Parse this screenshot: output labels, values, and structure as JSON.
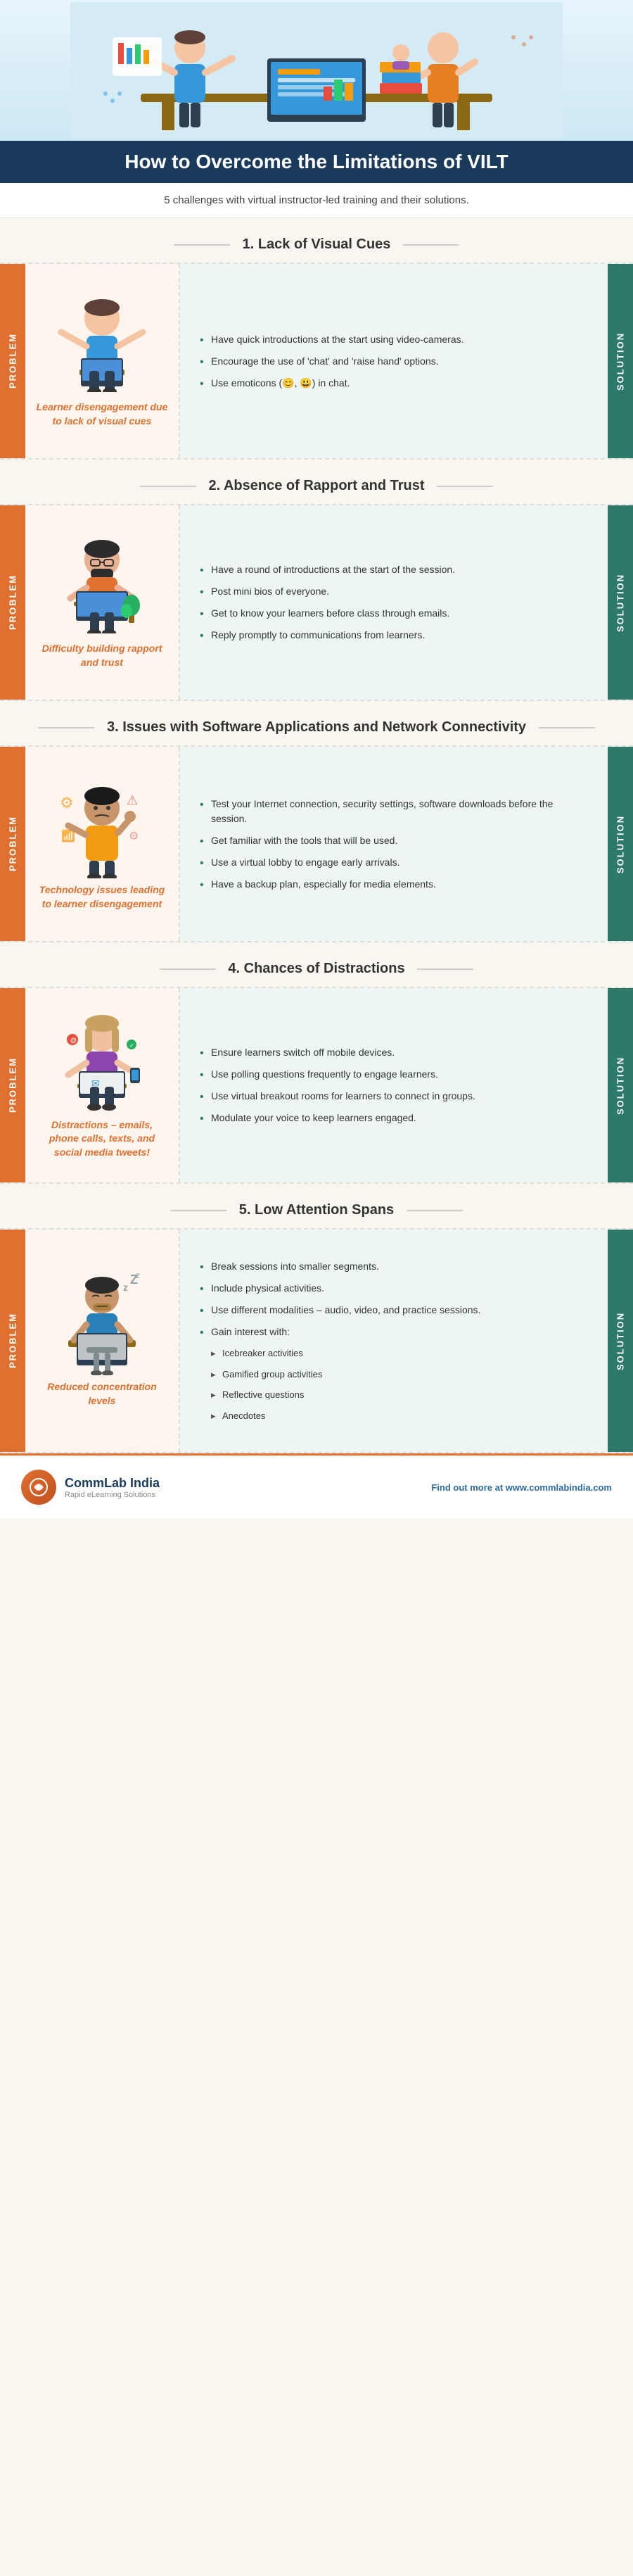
{
  "header": {
    "title": "How to Overcome the Limitations of VILT",
    "subtitle": "5 challenges with virtual instructor-led training and their solutions."
  },
  "sections": [
    {
      "number": "1.",
      "title": "Lack of Visual Cues",
      "problem_caption": "Learner disengagement due to lack of visual cues",
      "solutions": [
        "Have quick introductions at the start using video-cameras.",
        "Encourage the use of 'chat' and 'raise hand' options.",
        "Use emoticons (😊, 😃) in chat."
      ],
      "sub_solutions": []
    },
    {
      "number": "2.",
      "title": "Absence of Rapport and Trust",
      "problem_caption": "Difficulty building rapport and trust",
      "solutions": [
        "Have a round of introductions at the start of the session.",
        "Post mini bios of everyone.",
        "Get to know your learners before class through emails.",
        "Reply promptly to communications from learners."
      ],
      "sub_solutions": []
    },
    {
      "number": "3.",
      "title": "Issues with Software Applications and Network Connectivity",
      "problem_caption": "Technology issues leading to learner disengagement",
      "solutions": [
        "Test your Internet connection, security settings, software downloads before the session.",
        "Get familiar with the tools that will be used.",
        "Use a virtual lobby to engage early arrivals.",
        "Have a backup plan, especially for media elements."
      ],
      "sub_solutions": []
    },
    {
      "number": "4.",
      "title": "Chances of Distractions",
      "problem_caption": "Distractions – emails, phone calls, texts, and social media tweets!",
      "solutions": [
        "Ensure learners switch off mobile devices.",
        "Use polling questions frequently to engage learners.",
        "Use virtual breakout rooms for learners to connect in groups.",
        "Modulate your voice to keep learners engaged."
      ],
      "sub_solutions": []
    },
    {
      "number": "5.",
      "title": "Low Attention Spans",
      "problem_caption": "Reduced concentration levels",
      "solutions": [
        "Break sessions into smaller segments.",
        "Include physical activities.",
        "Use different modalities – audio, video, and practice sessions.",
        "Gain interest with:"
      ],
      "sub_solutions": [
        "Icebreaker activities",
        "Gamified group activities",
        "Reflective questions",
        "Anecdotes"
      ]
    }
  ],
  "footer": {
    "company_name": "CommLab India",
    "tagline": "Rapid eLearning Solutions",
    "url_prefix": "Find out more at ",
    "url": "www.commlabindia.com"
  },
  "labels": {
    "problem": "PROBLEM",
    "solution": "SOLUTION"
  }
}
